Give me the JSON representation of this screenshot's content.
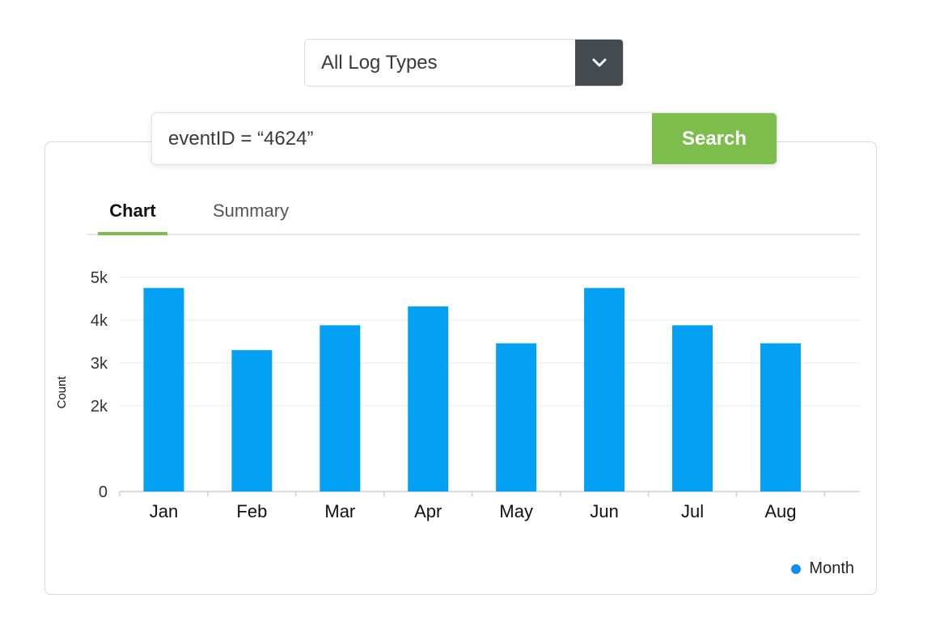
{
  "filter": {
    "selected": "All Log Types",
    "toggle_icon": "chevron-down-icon"
  },
  "search": {
    "query": "eventID = “4624”",
    "button_label": "Search"
  },
  "tabs": [
    {
      "label": "Chart",
      "active": true
    },
    {
      "label": "Summary",
      "active": false
    }
  ],
  "chart_data": {
    "type": "bar",
    "categories": [
      "Jan",
      "Feb",
      "Mar",
      "Apr",
      "May",
      "Jun",
      "Jul",
      "Aug"
    ],
    "series": [
      {
        "name": "Month",
        "values": [
          4750,
          3300,
          3880,
          4320,
          3460,
          4750,
          3880,
          3460
        ],
        "color": "#03a0f4"
      }
    ],
    "ylabel": "Count",
    "ylim": [
      0,
      5000
    ],
    "yticks": [
      0,
      2000,
      3000,
      4000,
      5000
    ],
    "ytick_labels": [
      "0",
      "2k",
      "3k",
      "4k",
      "5k"
    ],
    "grid": true,
    "legend": {
      "position": "bottom-right",
      "label": "Month",
      "color": "#0f8cf2"
    }
  }
}
